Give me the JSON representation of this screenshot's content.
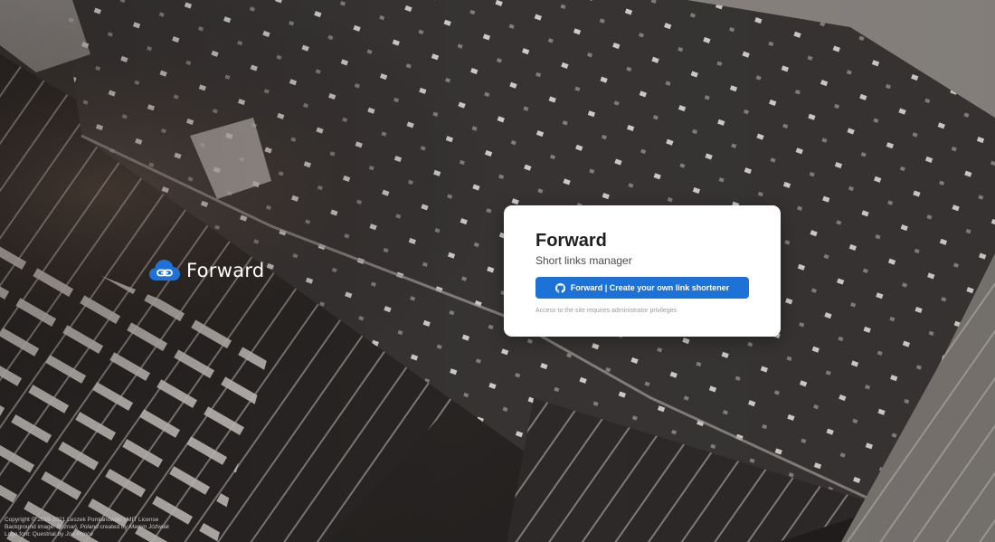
{
  "logo": {
    "text": "Forward",
    "icon": "cloud-link-icon",
    "color": "#1c72d6"
  },
  "card": {
    "title": "Forward",
    "subtitle": "Short links manager",
    "button": {
      "icon": "github-icon",
      "label": "Forward | Create your own link shortener"
    },
    "note": "Access to the site requires administrator privileges"
  },
  "footer": {
    "copyright": "Copyright © 2019-2021 Leszek Pomianowski | MIT License",
    "background_prefix": "Background image: ",
    "background_place": "Poznań, Poland",
    "background_middle": " created by ",
    "background_author": "Marcin Jóźwiak",
    "font_prefix": "Logo font: ",
    "font_name": "Questrial",
    "font_middle": " by ",
    "font_author": "Joe Prince"
  },
  "colors": {
    "accent": "#1c72d6",
    "card_bg": "#ffffff"
  }
}
